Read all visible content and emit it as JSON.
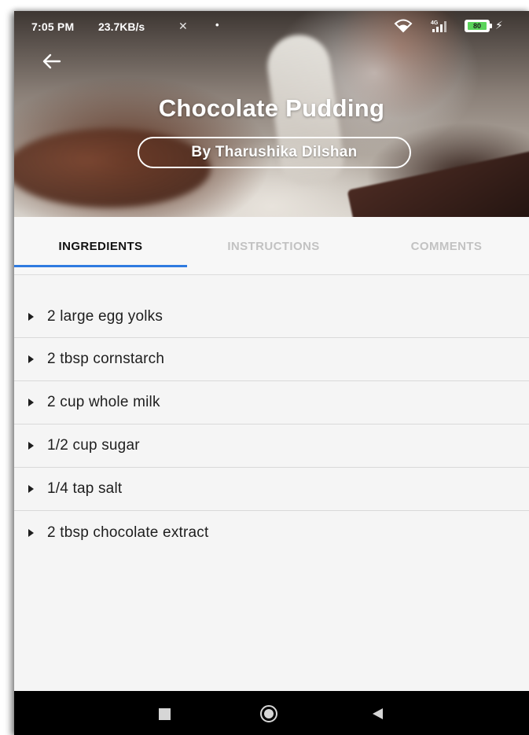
{
  "status_bar": {
    "time": "7:05 PM",
    "net_speed": "23.7KB/s",
    "battery_level": "80",
    "icons": [
      "mute-icon",
      "dot-icon",
      "wifi-icon",
      "signal-4g-icon",
      "battery-icon",
      "charging-icon"
    ]
  },
  "header": {
    "title": "Chocolate Pudding",
    "author": "By Tharushika Dilshan",
    "back_icon": "arrow-left-icon"
  },
  "tabs": [
    {
      "label": "INGREDIENTS",
      "active": true
    },
    {
      "label": "INSTRUCTIONS",
      "active": false
    },
    {
      "label": "COMMENTS",
      "active": false
    }
  ],
  "ingredients": [
    "2 large egg yolks",
    "2 tbsp cornstarch",
    "2 cup whole milk",
    "1/2 cup sugar",
    "1/4 tap salt",
    "2 tbsp chocolate extract"
  ],
  "navigation_bar": {
    "icons": [
      "recents-square-icon",
      "home-circle-icon",
      "back-triangle-icon"
    ]
  },
  "colors": {
    "accent": "#2f7be0",
    "active_tab_text": "#111111",
    "inactive_tab_text": "#c2c2c2",
    "nav_bar": "#000000",
    "battery_fill": "#5ad45a"
  }
}
